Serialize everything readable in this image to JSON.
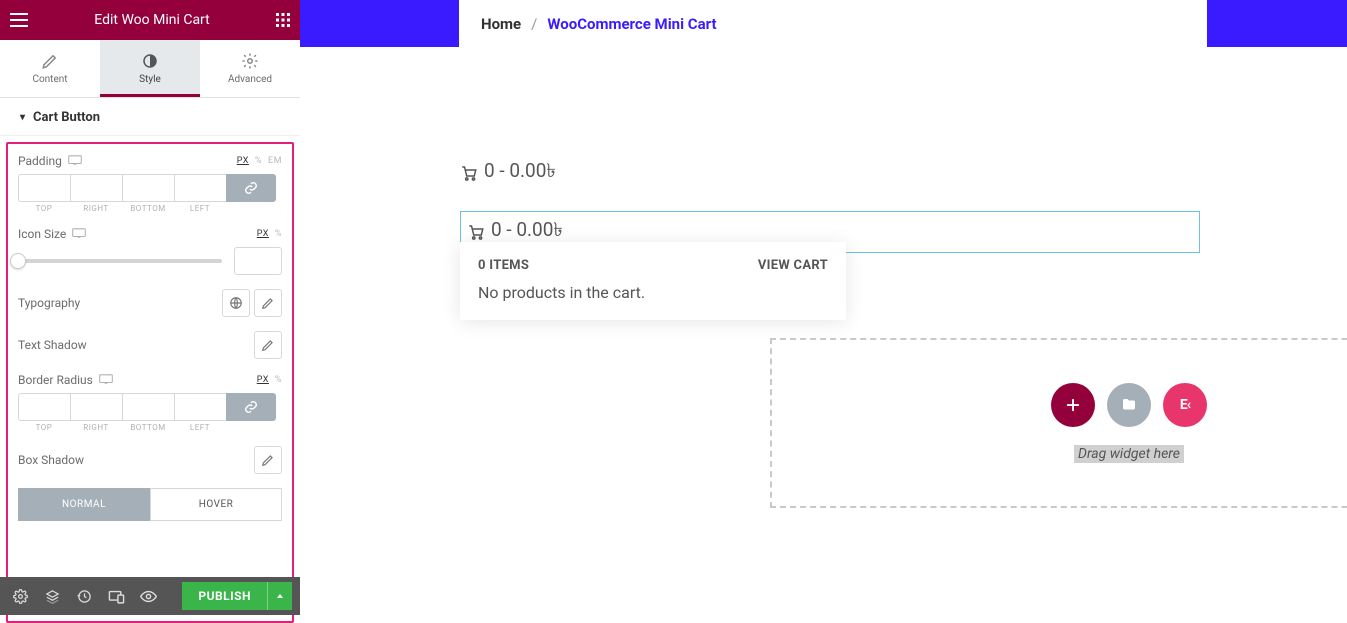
{
  "header": {
    "title": "Edit Woo Mini Cart"
  },
  "tabs": {
    "content": "Content",
    "style": "Style",
    "advanced": "Advanced"
  },
  "section": {
    "title": "Cart Button"
  },
  "controls": {
    "padding": {
      "label": "Padding",
      "units": {
        "px": "PX",
        "pct": "%",
        "em": "EM"
      },
      "sides": {
        "top": "TOP",
        "right": "RIGHT",
        "bottom": "BOTTOM",
        "left": "LEFT"
      }
    },
    "icon_size": {
      "label": "Icon Size",
      "units": {
        "px": "PX",
        "pct": "%"
      }
    },
    "typography": {
      "label": "Typography"
    },
    "text_shadow": {
      "label": "Text Shadow"
    },
    "border_radius": {
      "label": "Border Radius",
      "units": {
        "px": "PX",
        "pct": "%"
      },
      "sides": {
        "top": "TOP",
        "right": "RIGHT",
        "bottom": "BOTTOM",
        "left": "LEFT"
      }
    },
    "box_shadow": {
      "label": "Box Shadow"
    },
    "state_tabs": {
      "normal": "NORMAL",
      "hover": "HOVER"
    }
  },
  "footer": {
    "publish": "PUBLISH"
  },
  "preview": {
    "breadcrumb": {
      "home": "Home",
      "sep": "/",
      "current": "WooCommerce Mini Cart"
    },
    "cart_line": "0 - 0.00৳ ",
    "popup": {
      "items_label": "0 ITEMS",
      "view_cart": "VIEW CART",
      "empty": "No products in the cart."
    },
    "dropzone": {
      "hint": "Drag widget here"
    }
  }
}
